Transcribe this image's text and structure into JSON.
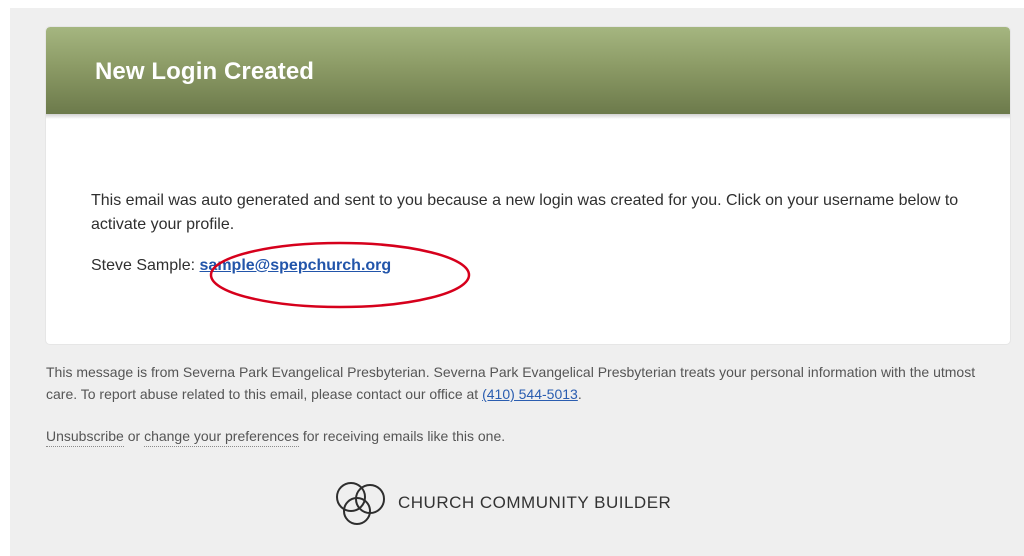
{
  "email": {
    "header": {
      "title": "New Login Created"
    },
    "body": {
      "message": "This email was auto generated and sent to you because a new login was created for you. Click on your username below to activate your profile.",
      "login_name": "Steve Sample:",
      "username_link": "sample@spepchurch.org"
    },
    "footer": {
      "notice_text": "This message is from Severna Park Evangelical Presbyterian. Severna Park Evangelical Presbyterian treats your personal information with the utmost care. To report abuse related to this email, please contact our office at",
      "phone_link": "(410) 544-5013",
      "notice_end": ".",
      "unsubscribe_link": "Unsubscribe",
      "or_text": "or",
      "preferences_link": "change your preferences",
      "preferences_suffix": "for receiving emails like this one."
    },
    "brand": {
      "name": "CHURCH COMMUNITY BUILDER",
      "logo_icon": "interlocking-rings-icon"
    }
  },
  "colors": {
    "header_gradient_top": "#a5b680",
    "header_gradient_bottom": "#6c7a4b",
    "link": "#2255aa",
    "annotation": "#d6001c"
  }
}
